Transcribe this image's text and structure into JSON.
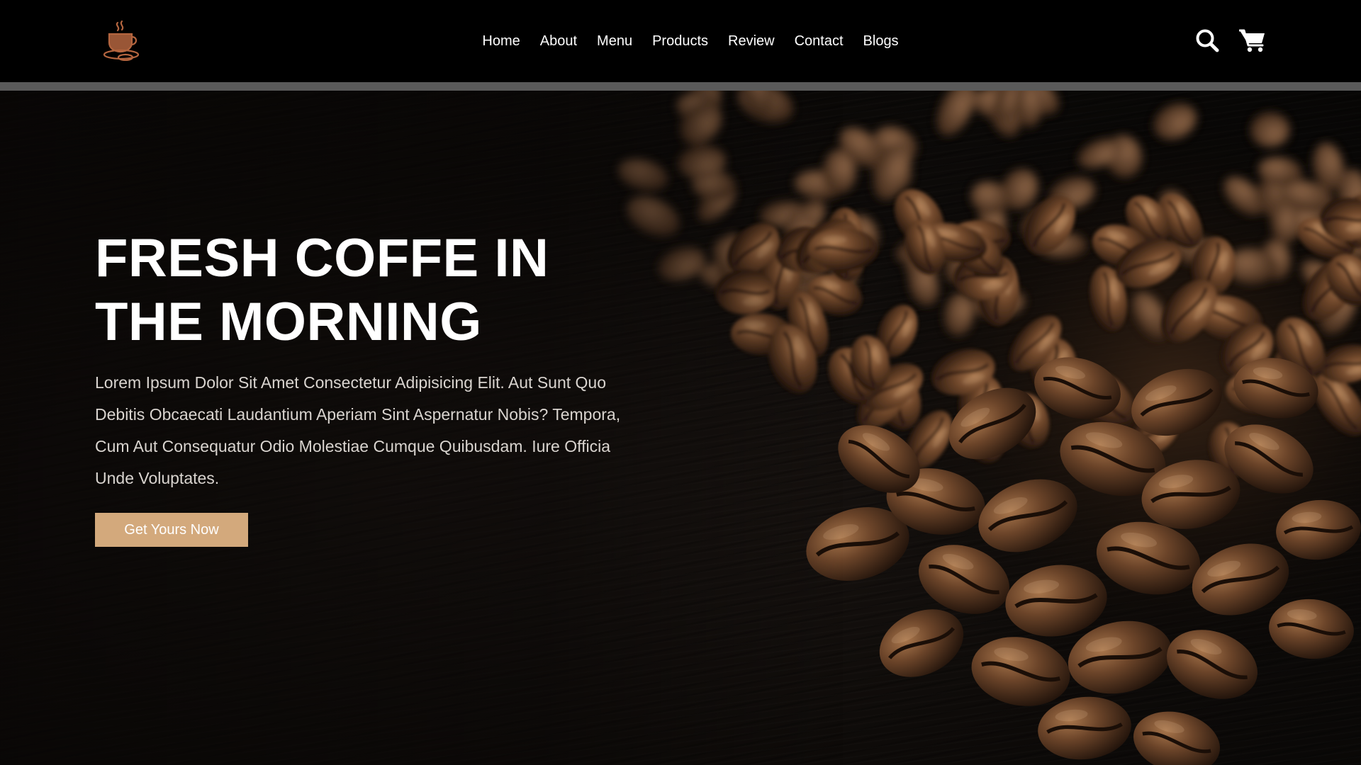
{
  "brand": {
    "logo_icon": "coffee-cup-icon",
    "logo_color": "#b4653f"
  },
  "nav": {
    "items": [
      {
        "label": "Home"
      },
      {
        "label": "About"
      },
      {
        "label": "Menu"
      },
      {
        "label": "Products"
      },
      {
        "label": "Review"
      },
      {
        "label": "Contact"
      },
      {
        "label": "Blogs"
      }
    ]
  },
  "header_icons": {
    "search_icon": "search-icon",
    "cart_icon": "shopping-cart-icon"
  },
  "hero": {
    "title": "FRESH COFFE IN THE MORNING",
    "description": "Lorem Ipsum Dolor Sit Amet Consectetur Adipisicing Elit. Aut Sunt Quo Debitis Obcaecati Laudantium Aperiam Sint Aspernatur Nobis? Tempora, Cum Aut Consequatur Odio Molestiae Cumque Quibusdam. Iure Officia Unde Voluptates.",
    "cta_label": "Get Yours Now",
    "background": "coffee-beans-photo"
  },
  "colors": {
    "header_bg": "#000000",
    "accent": "#d3a97c",
    "text_primary": "#ffffff"
  }
}
